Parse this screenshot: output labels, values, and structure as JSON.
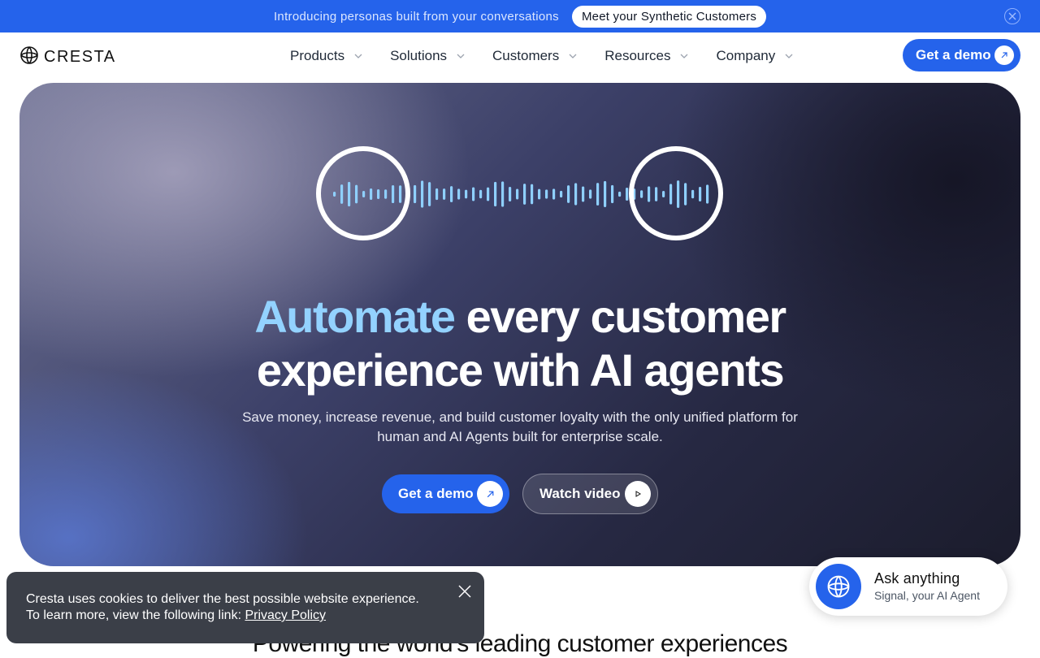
{
  "announcement": {
    "text": "Introducing personas built from your conversations",
    "pill": "Meet your Synthetic Customers",
    "close_icon": "close-icon"
  },
  "nav": {
    "logo_text": "CRESTA",
    "logo_icon": "cresta-logo-icon",
    "items": [
      {
        "label": "Products",
        "icon": "chevron-down-icon"
      },
      {
        "label": "Solutions",
        "icon": "chevron-down-icon"
      },
      {
        "label": "Customers",
        "icon": "chevron-down-icon"
      },
      {
        "label": "Resources",
        "icon": "chevron-down-icon"
      },
      {
        "label": "Company",
        "icon": "chevron-down-icon"
      }
    ],
    "cta": {
      "label": "Get a demo",
      "icon": "arrow-up-right-icon"
    }
  },
  "hero": {
    "headline_accent": "Automate",
    "headline_line1_rest": " every customer",
    "headline_line2": "experience with AI agents",
    "subheadline": "Save money, increase revenue, and build customer loyalty with the only unified platform for human and AI Agents built for enterprise scale.",
    "primary_cta": {
      "label": "Get a demo",
      "icon": "arrow-up-right-icon"
    },
    "secondary_cta": {
      "label": "Watch video",
      "icon": "play-icon"
    },
    "accent_color": "#93d2ff"
  },
  "section_heading": "Powering the world's leading customer experiences",
  "cookie_banner": {
    "text": "Cresta uses cookies to deliver the best possible website experience. To learn more, view the following link: ",
    "link": "Privacy Policy",
    "close_icon": "close-icon"
  },
  "assistant": {
    "title": "Ask anything",
    "subtitle": "Signal, your AI Agent",
    "icon": "signal-agent-icon"
  },
  "colors": {
    "brand_blue": "#2563eb",
    "cookie_bg": "#3b3f48"
  }
}
